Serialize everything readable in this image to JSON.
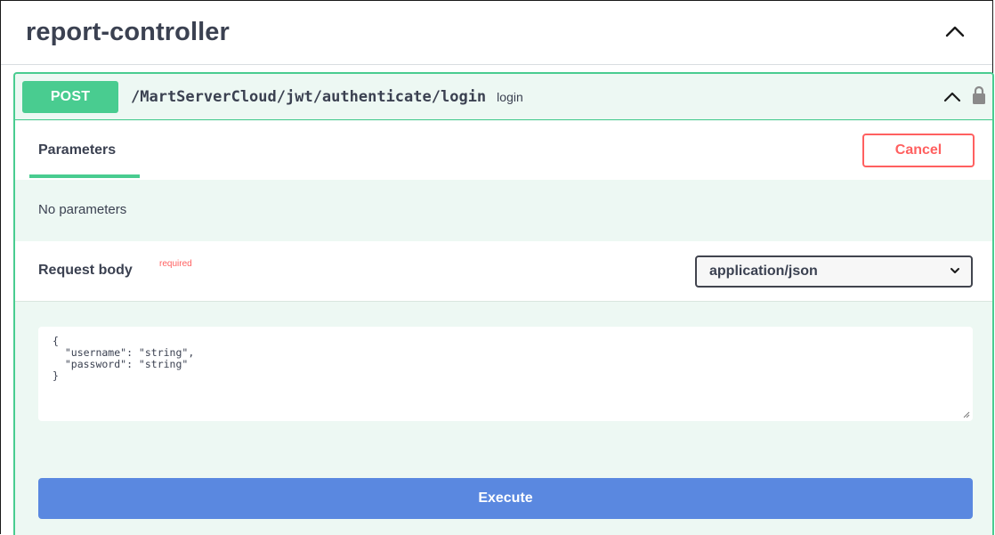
{
  "tag": {
    "title": "report-controller"
  },
  "operation": {
    "method": "POST",
    "path": "/MartServerCloud/jwt/authenticate/login",
    "description": "login"
  },
  "tabs": {
    "parameters_label": "Parameters",
    "cancel_label": "Cancel"
  },
  "parameters": {
    "empty_message": "No parameters"
  },
  "request_body": {
    "label": "Request body",
    "required_label": "required",
    "content_type": "application/json",
    "example": "{\n  \"username\": \"string\",\n  \"password\": \"string\"\n}"
  },
  "actions": {
    "execute_label": "Execute"
  },
  "colors": {
    "post_accent": "#49cc90",
    "post_background": "#edf8f3",
    "cancel": "#ff6060",
    "execute": "#5a88e0",
    "text": "#3b4151"
  },
  "icons": {
    "tag_toggle": "chevron-up-icon",
    "operation_toggle": "chevron-up-icon",
    "authorization": "lock-icon",
    "select_arrow": "chevron-down-icon",
    "resize": "resize-grip-icon"
  }
}
